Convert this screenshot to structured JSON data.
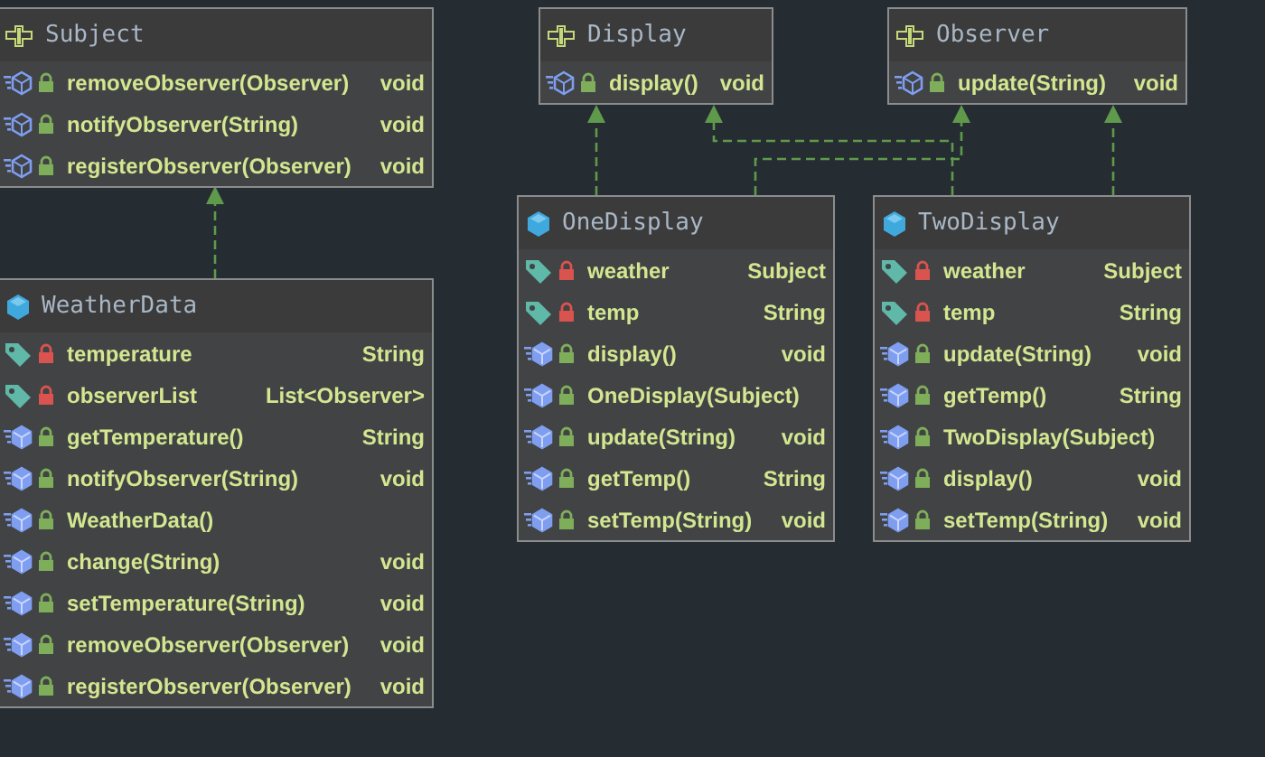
{
  "classes": [
    {
      "kind": "interface",
      "name": "Subject",
      "members": [
        {
          "kind": "abstract_method",
          "private": false,
          "name": "removeObserver(Observer)",
          "type": "void"
        },
        {
          "kind": "abstract_method",
          "private": false,
          "name": "notifyObserver(String)",
          "type": "void"
        },
        {
          "kind": "abstract_method",
          "private": false,
          "name": "registerObserver(Observer)",
          "type": "void"
        }
      ]
    },
    {
      "kind": "class",
      "name": "WeatherData",
      "members": [
        {
          "kind": "field",
          "private": true,
          "name": "temperature",
          "type": "String"
        },
        {
          "kind": "field",
          "private": true,
          "name": "observerList",
          "type": "List<Observer>"
        },
        {
          "kind": "method",
          "private": false,
          "name": "getTemperature()",
          "type": "String"
        },
        {
          "kind": "method",
          "private": false,
          "name": "notifyObserver(String)",
          "type": "void"
        },
        {
          "kind": "method",
          "private": false,
          "name": "WeatherData()"
        },
        {
          "kind": "method",
          "private": false,
          "name": "change(String)",
          "type": "void"
        },
        {
          "kind": "method",
          "private": false,
          "name": "setTemperature(String)",
          "type": "void"
        },
        {
          "kind": "method",
          "private": false,
          "name": "removeObserver(Observer)",
          "type": "void"
        },
        {
          "kind": "method",
          "private": false,
          "name": "registerObserver(Observer)",
          "type": "void"
        }
      ]
    },
    {
      "kind": "interface",
      "name": "Display",
      "members": [
        {
          "kind": "abstract_method",
          "private": false,
          "name": "display()",
          "type": "void"
        }
      ]
    },
    {
      "kind": "class",
      "name": "OneDisplay",
      "members": [
        {
          "kind": "field",
          "private": true,
          "name": "weather",
          "type": "Subject"
        },
        {
          "kind": "field",
          "private": true,
          "name": "temp",
          "type": "String"
        },
        {
          "kind": "method",
          "private": false,
          "name": "display()",
          "type": "void"
        },
        {
          "kind": "method",
          "private": false,
          "name": "OneDisplay(Subject)"
        },
        {
          "kind": "method",
          "private": false,
          "name": "update(String)",
          "type": "void"
        },
        {
          "kind": "method",
          "private": false,
          "name": "getTemp()",
          "type": "String"
        },
        {
          "kind": "method",
          "private": false,
          "name": "setTemp(String)",
          "type": "void"
        }
      ]
    },
    {
      "kind": "interface",
      "name": "Observer",
      "members": [
        {
          "kind": "abstract_method",
          "private": false,
          "name": "update(String)",
          "type": "void"
        }
      ]
    },
    {
      "kind": "class",
      "name": "TwoDisplay",
      "members": [
        {
          "kind": "field",
          "private": true,
          "name": "weather",
          "type": "Subject"
        },
        {
          "kind": "field",
          "private": true,
          "name": "temp",
          "type": "String"
        },
        {
          "kind": "method",
          "private": false,
          "name": "update(String)",
          "type": "void"
        },
        {
          "kind": "method",
          "private": false,
          "name": "getTemp()",
          "type": "String"
        },
        {
          "kind": "method",
          "private": false,
          "name": "TwoDisplay(Subject)"
        },
        {
          "kind": "method",
          "private": false,
          "name": "display()",
          "type": "void"
        },
        {
          "kind": "method",
          "private": false,
          "name": "setTemp(String)",
          "type": "void"
        }
      ]
    }
  ]
}
